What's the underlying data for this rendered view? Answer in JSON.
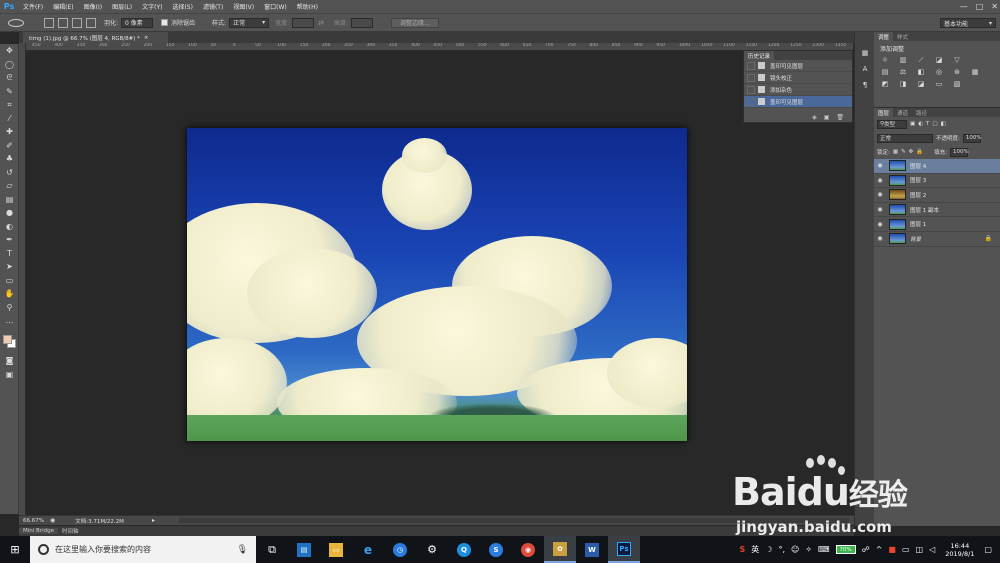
{
  "app": {
    "logo": "Ps",
    "menu": [
      "文件(F)",
      "编辑(E)",
      "图像(I)",
      "图层(L)",
      "文字(Y)",
      "选择(S)",
      "滤镜(T)",
      "视图(V)",
      "窗口(W)",
      "帮助(H)"
    ],
    "window_buttons": [
      "—",
      "□",
      "✕"
    ]
  },
  "options_bar": {
    "feather_label": "羽化:",
    "feather_value": "0 像素",
    "antialias_label": "消除锯齿",
    "style_label": "样式:",
    "style_value": "正常",
    "width_label": "宽度:",
    "height_label": "高度:",
    "refine_edge_label": "调整边缘...",
    "workspace": "基本功能"
  },
  "document": {
    "tab_title": "timg (1).jpg @ 66.7% (图层 4, RGB/8#) *",
    "tab_close": "×",
    "zoom": "66.67%",
    "doc_size": "文档:3.71M/22.2M",
    "ruler_ticks": [
      "450",
      "400",
      "350",
      "300",
      "250",
      "200",
      "150",
      "100",
      "50",
      "0",
      "50",
      "100",
      "150",
      "200",
      "250",
      "300",
      "350",
      "400",
      "450",
      "500",
      "550",
      "600",
      "650",
      "700",
      "750",
      "800",
      "850",
      "900",
      "950",
      "1000",
      "1050",
      "1100",
      "1150",
      "1200",
      "1250",
      "1300",
      "1350"
    ]
  },
  "mini_bridge": {
    "tabs": [
      "Mini Bridge",
      "时间轴"
    ]
  },
  "history": {
    "title": "历史记录",
    "items": [
      {
        "label": "盖印可见图层",
        "active": false
      },
      {
        "label": "镜头校正",
        "active": false
      },
      {
        "label": "添加杂色",
        "active": false
      },
      {
        "label": "盖印可见图层",
        "active": true
      }
    ]
  },
  "adjustments": {
    "tabs": [
      "调整",
      "样式"
    ],
    "title": "添加调整"
  },
  "layers": {
    "tabs": [
      "图层",
      "通道",
      "路径"
    ],
    "filter_kind": "类型",
    "blend_mode": "正常",
    "opacity_label": "不透明度:",
    "opacity_value": "100%",
    "lock_label": "锁定:",
    "fill_label": "填充:",
    "fill_value": "100%",
    "items": [
      {
        "name": "图层 4",
        "active": true,
        "warm": false,
        "locked": false
      },
      {
        "name": "图层 3",
        "active": false,
        "warm": false,
        "locked": false
      },
      {
        "name": "图层 2",
        "active": false,
        "warm": true,
        "locked": false
      },
      {
        "name": "图层 1 副本",
        "active": false,
        "warm": false,
        "locked": false
      },
      {
        "name": "图层 1",
        "active": false,
        "warm": false,
        "locked": false
      },
      {
        "name": "背景",
        "active": false,
        "warm": false,
        "locked": true
      }
    ]
  },
  "taskbar": {
    "search_placeholder": "在这里输入你要搜索的内容",
    "battery": "70%",
    "ime": "英",
    "time": "16:44",
    "date": "2019/8/1"
  },
  "watermark": {
    "brand": "Bai",
    "brand_tail": "经验",
    "url": "jingyan.baidu.com"
  }
}
